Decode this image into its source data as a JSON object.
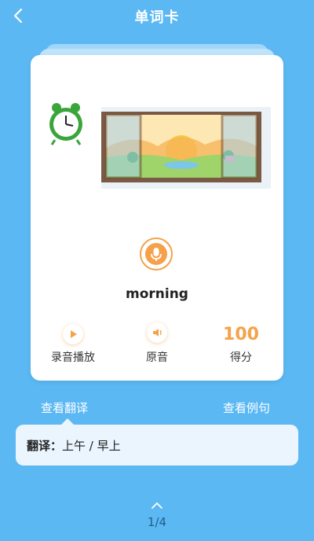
{
  "header": {
    "title": "单词卡",
    "back_icon": "chevron-left-icon"
  },
  "card": {
    "image": "morning-clock-window-sunrise",
    "word": "morning",
    "mic_icon": "microphone-icon",
    "actions": {
      "record_play_label": "录音播放",
      "record_play_icon": "play-icon",
      "original_label": "原音",
      "original_icon": "speaker-icon",
      "score_value": "100",
      "score_label": "得分"
    }
  },
  "tabs": {
    "translation": "查看翻译",
    "example": "查看例句"
  },
  "translation": {
    "label": "翻译：",
    "text": "上午 / 早上"
  },
  "pager": {
    "up_icon": "chevron-up-icon",
    "page": "1/4"
  },
  "colors": {
    "background": "#5bb8f3",
    "accent": "#f5a24a",
    "card": "#ffffff"
  }
}
